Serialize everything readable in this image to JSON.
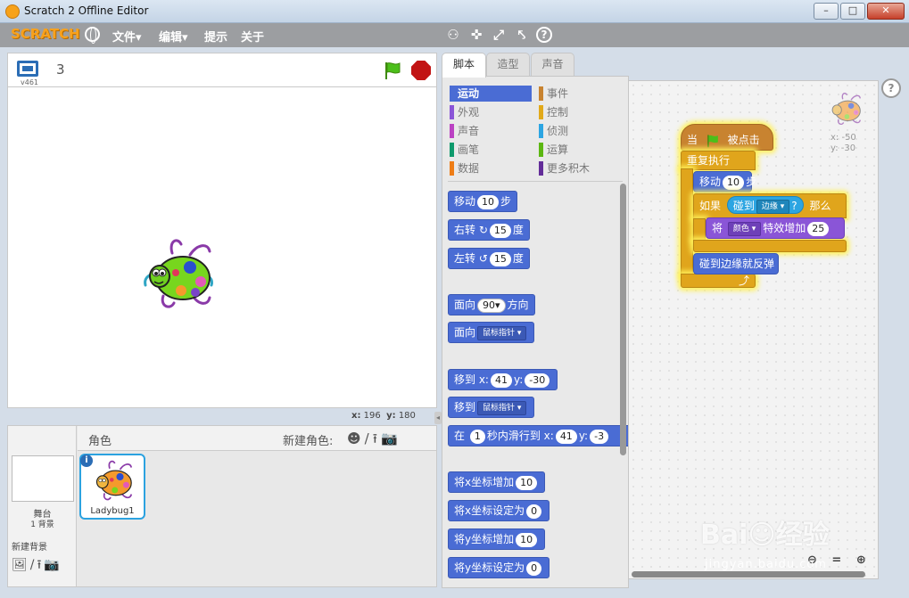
{
  "window": {
    "title": "Scratch 2 Offline Editor",
    "min_label": "–",
    "max_label": "□",
    "close_label": "✕"
  },
  "menubar": {
    "logo": "SCRATCH",
    "items": [
      "文件▾",
      "编辑▾",
      "提示",
      "关于"
    ],
    "tools": [
      "⚇",
      "✜",
      "⤢",
      "⤣",
      "?"
    ]
  },
  "stage": {
    "version": "v461",
    "sprite_count": "3",
    "mouse_x_label": "x:",
    "mouse_x": "196",
    "mouse_y_label": "y:",
    "mouse_y": "180"
  },
  "sprite_pane": {
    "stage_label": "舞台",
    "backdrop_count": "1 背景",
    "new_backdrop_label": "新建背景",
    "new_backdrop_icons": "🖼/⭱📷",
    "sprites_title": "角色",
    "new_sprite_label": "新建角色:",
    "new_sprite_icons": "☻/⭱📷",
    "sprite_name": "Ladybug1",
    "info_icon": "i"
  },
  "tabs": [
    "脚本",
    "造型",
    "声音"
  ],
  "categories": {
    "left": [
      {
        "label": "运动",
        "color": "#4a6cd4"
      },
      {
        "label": "外观",
        "color": "#8a55d7"
      },
      {
        "label": "声音",
        "color": "#bb42c3"
      },
      {
        "label": "画笔",
        "color": "#0e9a6c"
      },
      {
        "label": "数据",
        "color": "#ee7d16"
      }
    ],
    "right": [
      {
        "label": "事件",
        "color": "#c88330"
      },
      {
        "label": "控制",
        "color": "#e1a91a"
      },
      {
        "label": "侦测",
        "color": "#2ca5e2"
      },
      {
        "label": "运算",
        "color": "#5cb712"
      },
      {
        "label": "更多积木",
        "color": "#632d99"
      }
    ]
  },
  "palette_blocks": {
    "move": {
      "a": "移动",
      "v": "10",
      "b": "步"
    },
    "turn_right": {
      "a": "右转",
      "icon": "↻",
      "v": "15",
      "b": "度"
    },
    "turn_left": {
      "a": "左转",
      "icon": "↺",
      "v": "15",
      "b": "度"
    },
    "point_dir": {
      "a": "面向",
      "v": "90▾",
      "b": "方向"
    },
    "point_towards": {
      "a": "面向",
      "dd": "鼠标指针 ▾"
    },
    "goto_xy": {
      "a": "移到 x:",
      "x": "41",
      "b": "y:",
      "y": "-30"
    },
    "goto": {
      "a": "移到",
      "dd": "鼠标指针 ▾"
    },
    "glide": {
      "a": "在",
      "secs": "1",
      "b": "秒内滑行到 x:",
      "x": "41",
      "c": "y:",
      "y": "-3"
    },
    "change_x": {
      "a": "将x坐标增加",
      "v": "10"
    },
    "set_x": {
      "a": "将x坐标设定为",
      "v": "0"
    },
    "change_y": {
      "a": "将y坐标增加",
      "v": "10"
    },
    "set_y": {
      "a": "将y坐标设定为",
      "v": "0"
    }
  },
  "script": {
    "hat_a": "当",
    "hat_b": "被点击",
    "forever": "重复执行",
    "move_a": "移动",
    "move_v": "10",
    "move_b": "步",
    "if_a": "如果",
    "touching_a": "碰到",
    "touching_dd": "边缘 ▾",
    "touching_q": "?",
    "if_b": "那么",
    "effect_a": "将",
    "effect_dd": "颜色 ▾",
    "effect_b": "特效增加",
    "effect_v": "25",
    "bounce": "碰到边缘就反弹",
    "loop_arrow": "⤴",
    "sprite_x": "x: -50",
    "sprite_y": "y: -30"
  },
  "zoom": {
    "icons": "⊖ = ⊕"
  },
  "help": "?",
  "watermark": {
    "main": "Bai☺经验",
    "url": "jingyan.baidu.com"
  }
}
